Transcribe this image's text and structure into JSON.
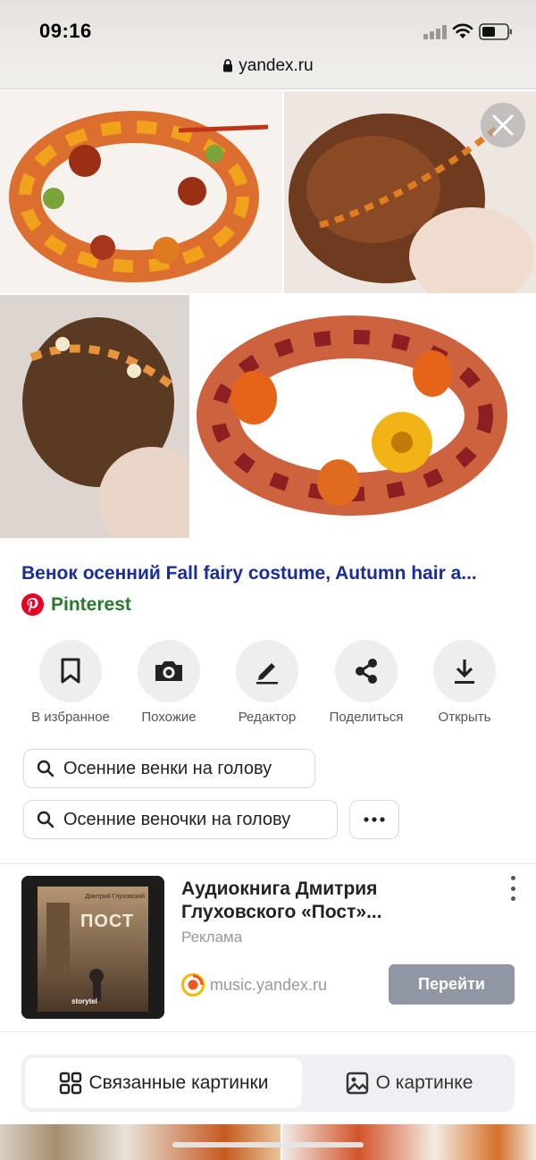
{
  "status": {
    "time": "09:16"
  },
  "browser": {
    "url": "yandex.ru"
  },
  "result": {
    "title": "Венок осенний Fall fairy costume, Autumn hair a...",
    "source": "Pinterest"
  },
  "actions": [
    {
      "label": "В избранное",
      "icon": "bookmark-icon"
    },
    {
      "label": "Похожие",
      "icon": "camera-icon"
    },
    {
      "label": "Редактор",
      "icon": "pencil-icon"
    },
    {
      "label": "Поделиться",
      "icon": "share-icon"
    },
    {
      "label": "Открыть",
      "icon": "download-icon"
    }
  ],
  "suggestions": [
    "Осенние венки на голову",
    "Осенние веночки на голову"
  ],
  "ad": {
    "title": "Аудиокнига Дмитрия Глуховского «Пост»...",
    "label": "Реклама",
    "domain": "music.yandex.ru",
    "button": "Перейти",
    "cover_author": "Дмитрий Глуховский",
    "cover_title": "ПОСТ",
    "cover_brand": "storytel"
  },
  "tabs": {
    "related": "Связанные картинки",
    "about": "О картинке"
  },
  "colors": {
    "title_link": "#1a2d99",
    "source": "#2b7a2b",
    "pinterest": "#e60023",
    "button": "#9097a3"
  }
}
